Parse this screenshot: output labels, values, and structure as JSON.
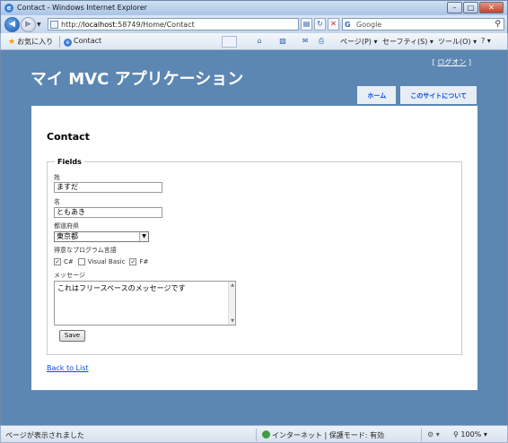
{
  "window": {
    "title": "Contact - Windows Internet Explorer",
    "minimize": "–",
    "maximize": "□",
    "close": "✕"
  },
  "navbar": {
    "url_prefix": "http://",
    "url_host": "localhost",
    "url_rest": ":58749/Home/Contact",
    "search_placeholder": "Google"
  },
  "favbar": {
    "favorites_label": "お気に入り",
    "tab_label": "Contact",
    "page_menu": "ページ(P) ▾",
    "safety_menu": "セーフティ(S) ▾",
    "tools_menu": "ツール(O) ▾",
    "help_menu": "? ▾"
  },
  "site": {
    "logon_link": "ログオン",
    "title": "マイ MVC アプリケーション",
    "menu": [
      {
        "label": "ホーム"
      },
      {
        "label": "このサイトについて"
      }
    ]
  },
  "form": {
    "heading": "Contact",
    "legend": "Fields",
    "last_name_label": "姓",
    "last_name_value": "ますだ",
    "first_name_label": "名",
    "first_name_value": "ともあき",
    "prefecture_label": "都道府県",
    "prefecture_value": "東京都",
    "languages_label": "得意なプログラム言語",
    "languages": [
      {
        "label": "C#",
        "checked": true
      },
      {
        "label": "Visual Basic",
        "checked": false
      },
      {
        "label": "F#",
        "checked": true
      }
    ],
    "message_label": "メッセージ",
    "message_value": "これはフリースペースのメッセージです",
    "save_label": "Save",
    "back_link": "Back to List"
  },
  "status": {
    "left_text": "ページが表示されました",
    "zone_text": "インターネット | 保護モード: 有効",
    "zoom": "100%"
  },
  "colors": {
    "page_bg": "#5c87b2",
    "link": "#034af3",
    "menu_bg": "#e8eef4"
  }
}
